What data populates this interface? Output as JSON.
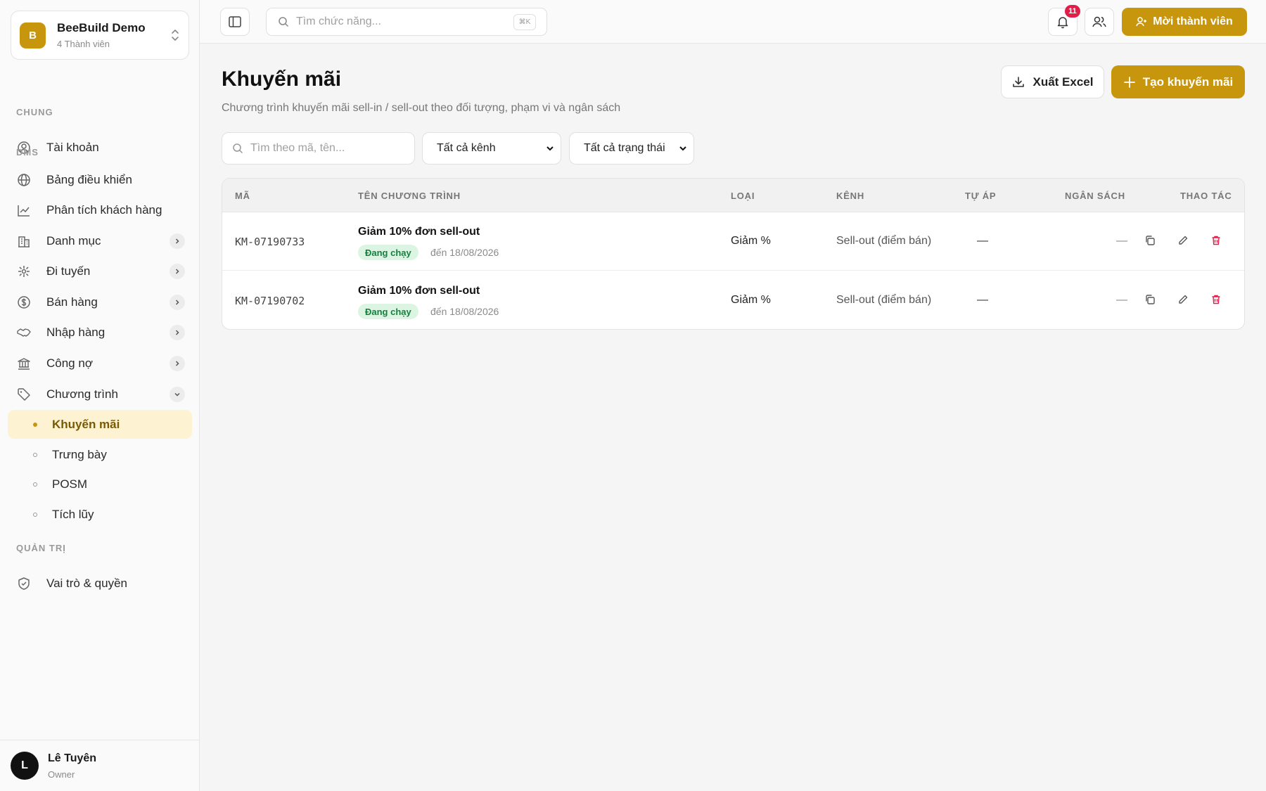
{
  "workspace": {
    "initial": "B",
    "name": "BeeBuild Demo",
    "members": "4 Thành viên"
  },
  "sidebar": {
    "sections": {
      "general": "CHUNG",
      "dms": "DMS",
      "admin": "QUẢN TRỊ"
    },
    "account": "Tài khoản",
    "dms_items": [
      {
        "label": "Bảng điều khiển",
        "icon": "globe-icon"
      },
      {
        "label": "Phân tích khách hàng",
        "icon": "chart-line-icon"
      },
      {
        "label": "Danh mục",
        "icon": "building-icon"
      },
      {
        "label": "Đi tuyến",
        "icon": "route-icon"
      },
      {
        "label": "Bán hàng",
        "icon": "dollar-icon"
      },
      {
        "label": "Nhập hàng",
        "icon": "handshake-icon"
      },
      {
        "label": "Công nợ",
        "icon": "bank-icon"
      },
      {
        "label": "Chương trình",
        "icon": "tag-icon"
      }
    ],
    "sub_items": [
      "Khuyến mãi",
      "Trưng bày",
      "POSM",
      "Tích lũy"
    ],
    "admin_items": [
      "Vai trò & quyền"
    ]
  },
  "user": {
    "initial": "L",
    "name": "Lê Tuyên",
    "role": "Owner"
  },
  "topbar": {
    "search_placeholder": "Tìm chức năng...",
    "shortcut": "⌘K",
    "notification_count": "11",
    "invite_label": "Mời thành viên"
  },
  "page": {
    "title": "Khuyến mãi",
    "subtitle": "Chương trình khuyến mãi sell-in / sell-out theo đối tượng, phạm vi và ngân sách",
    "export_label": "Xuất Excel",
    "create_label": "Tạo khuyến mãi"
  },
  "filters": {
    "search_placeholder": "Tìm theo mã, tên...",
    "channel": "Tất cả kênh",
    "status": "Tất cả trạng thái"
  },
  "table": {
    "headers": [
      "MÃ",
      "TÊN CHƯƠNG TRÌNH",
      "LOẠI",
      "KÊNH",
      "TỰ ÁP",
      "NGÂN SÁCH",
      "THAO TÁC"
    ],
    "rows": [
      {
        "code": "KM-07190733",
        "name": "Giảm 10% đơn sell-out",
        "status": "Đang chạy",
        "until": "đến 18/08/2026",
        "type": "Giảm %",
        "channel": "Sell-out (điểm bán)",
        "auto": "—",
        "budget": "—"
      },
      {
        "code": "KM-07190702",
        "name": "Giảm 10% đơn sell-out",
        "status": "Đang chạy",
        "until": "đến 18/08/2026",
        "type": "Giảm %",
        "channel": "Sell-out (điểm bán)",
        "auto": "—",
        "budget": "—"
      }
    ]
  },
  "colors": {
    "accent": "#c8960c",
    "danger": "#e11d48",
    "success": "#15803d"
  }
}
